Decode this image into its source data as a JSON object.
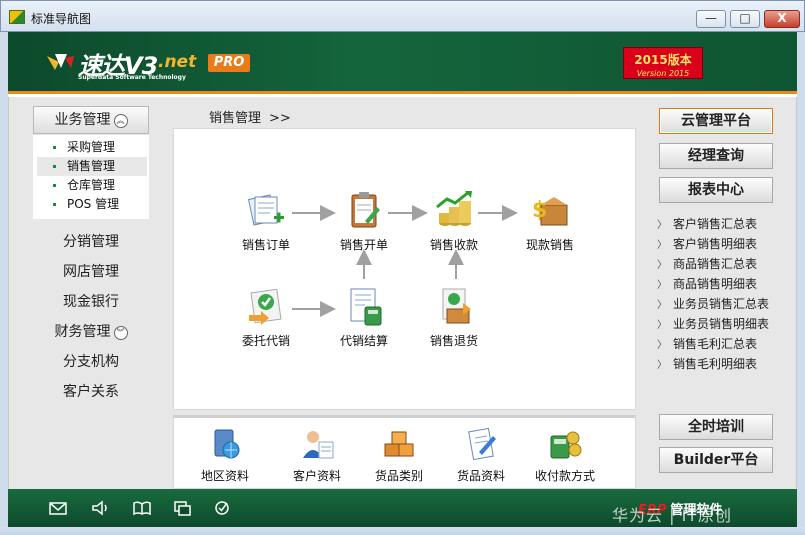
{
  "window": {
    "title": "标准导航图",
    "minimize": "—",
    "maximize": "□",
    "close": "X"
  },
  "header": {
    "logo_text": "速达V3",
    "logo_net": ".net",
    "logo_subtitle": "Superdata Software Technology",
    "pro_badge": "PRO",
    "version_title": "2015版本",
    "version_sub": "Version 2015"
  },
  "left_nav": {
    "group_expanded": {
      "label": "业务管理",
      "icon": "chevron-circle"
    },
    "submenu": [
      {
        "label": "采购管理",
        "active": false
      },
      {
        "label": "销售管理",
        "active": true
      },
      {
        "label": "仓库管理",
        "active": false
      },
      {
        "label": "POS 管理",
        "active": false
      }
    ],
    "items": [
      {
        "label": "分销管理",
        "has_chevron": false
      },
      {
        "label": "网店管理",
        "has_chevron": false
      },
      {
        "label": "现金银行",
        "has_chevron": false
      },
      {
        "label": "财务管理",
        "has_chevron": true
      },
      {
        "label": "分支机构",
        "has_chevron": false
      },
      {
        "label": "客户关系",
        "has_chevron": false
      }
    ]
  },
  "breadcrumb": {
    "label": "销售管理",
    "sep": ">>"
  },
  "flow": {
    "nodes": [
      {
        "label": "销售订单",
        "icon": "sales-order-icon"
      },
      {
        "label": "销售开单",
        "icon": "sales-invoice-icon"
      },
      {
        "label": "销售收款",
        "icon": "sales-receipt-icon"
      },
      {
        "label": "现款销售",
        "icon": "cash-sales-icon"
      },
      {
        "label": "委托代销",
        "icon": "consignment-icon"
      },
      {
        "label": "代销结算",
        "icon": "consignment-settlement-icon"
      },
      {
        "label": "销售退货",
        "icon": "sales-return-icon"
      }
    ]
  },
  "tools": [
    {
      "label": "地区资料",
      "icon": "region-data-icon"
    },
    {
      "label": "客户资料",
      "icon": "customer-data-icon"
    },
    {
      "label": "货品类别",
      "icon": "goods-category-icon"
    },
    {
      "label": "货品资料",
      "icon": "goods-data-icon"
    },
    {
      "label": "收付款方式",
      "icon": "payment-method-icon"
    }
  ],
  "right_panel": {
    "buttons_top": [
      "云管理平台",
      "经理查询",
      "报表中心"
    ],
    "report_links": [
      "客户销售汇总表",
      "客户销售明细表",
      "商品销售汇总表",
      "商品销售明细表",
      "业务员销售汇总表",
      "业务员销售明细表",
      "销售毛利汇总表",
      "销售毛利明细表"
    ],
    "buttons_bottom": [
      "全时培训",
      "Builder平台"
    ]
  },
  "footer": {
    "icons": [
      "mail-icon",
      "speaker-icon",
      "book-icon",
      "windows-icon",
      "check-refresh-icon"
    ],
    "erp_label": "ERP",
    "brand": "管理软件",
    "watermark": "华为云 | IT原创"
  },
  "colors": {
    "header_green": "#14653c",
    "footer_green": "#0d4a2b",
    "accent_orange": "#e88a20",
    "version_red": "#d8001a"
  }
}
